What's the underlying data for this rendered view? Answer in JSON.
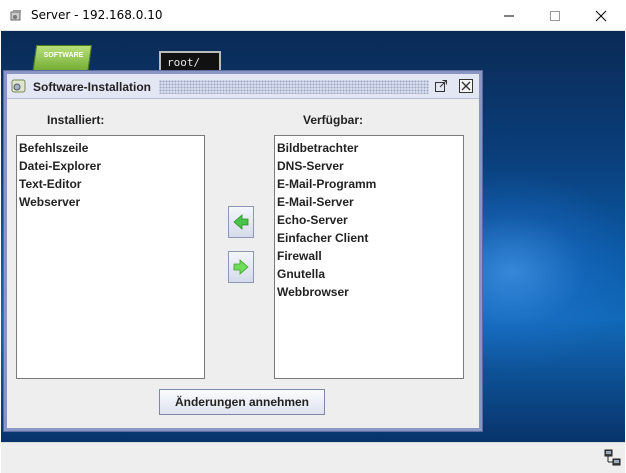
{
  "window": {
    "title": "Server - 192.168.0.10",
    "controls": {
      "minimize": "minimize-icon",
      "maximize": "maximize-icon",
      "close": "close-icon"
    }
  },
  "desktop": {
    "icons": [
      {
        "label": "SOFTWARE",
        "icon": "software-installer-icon"
      },
      {
        "label": "root/",
        "icon": "terminal-icon"
      }
    ]
  },
  "dialog": {
    "title": "Software-Installation",
    "installed_label": "Installiert:",
    "available_label": "Verfügbar:",
    "installed": [
      "Befehlszeile",
      "Datei-Explorer",
      "Text-Editor",
      "Webserver"
    ],
    "available": [
      "Bildbetrachter",
      "DNS-Server",
      "E-Mail-Programm",
      "E-Mail-Server",
      "Echo-Server",
      "Einfacher Client",
      "Firewall",
      "Gnutella",
      "Webbrowser"
    ],
    "apply_button": "Änderungen annehmen",
    "colors": {
      "border": "#8a97c5",
      "arrow_green": "#3fbf3f"
    }
  }
}
